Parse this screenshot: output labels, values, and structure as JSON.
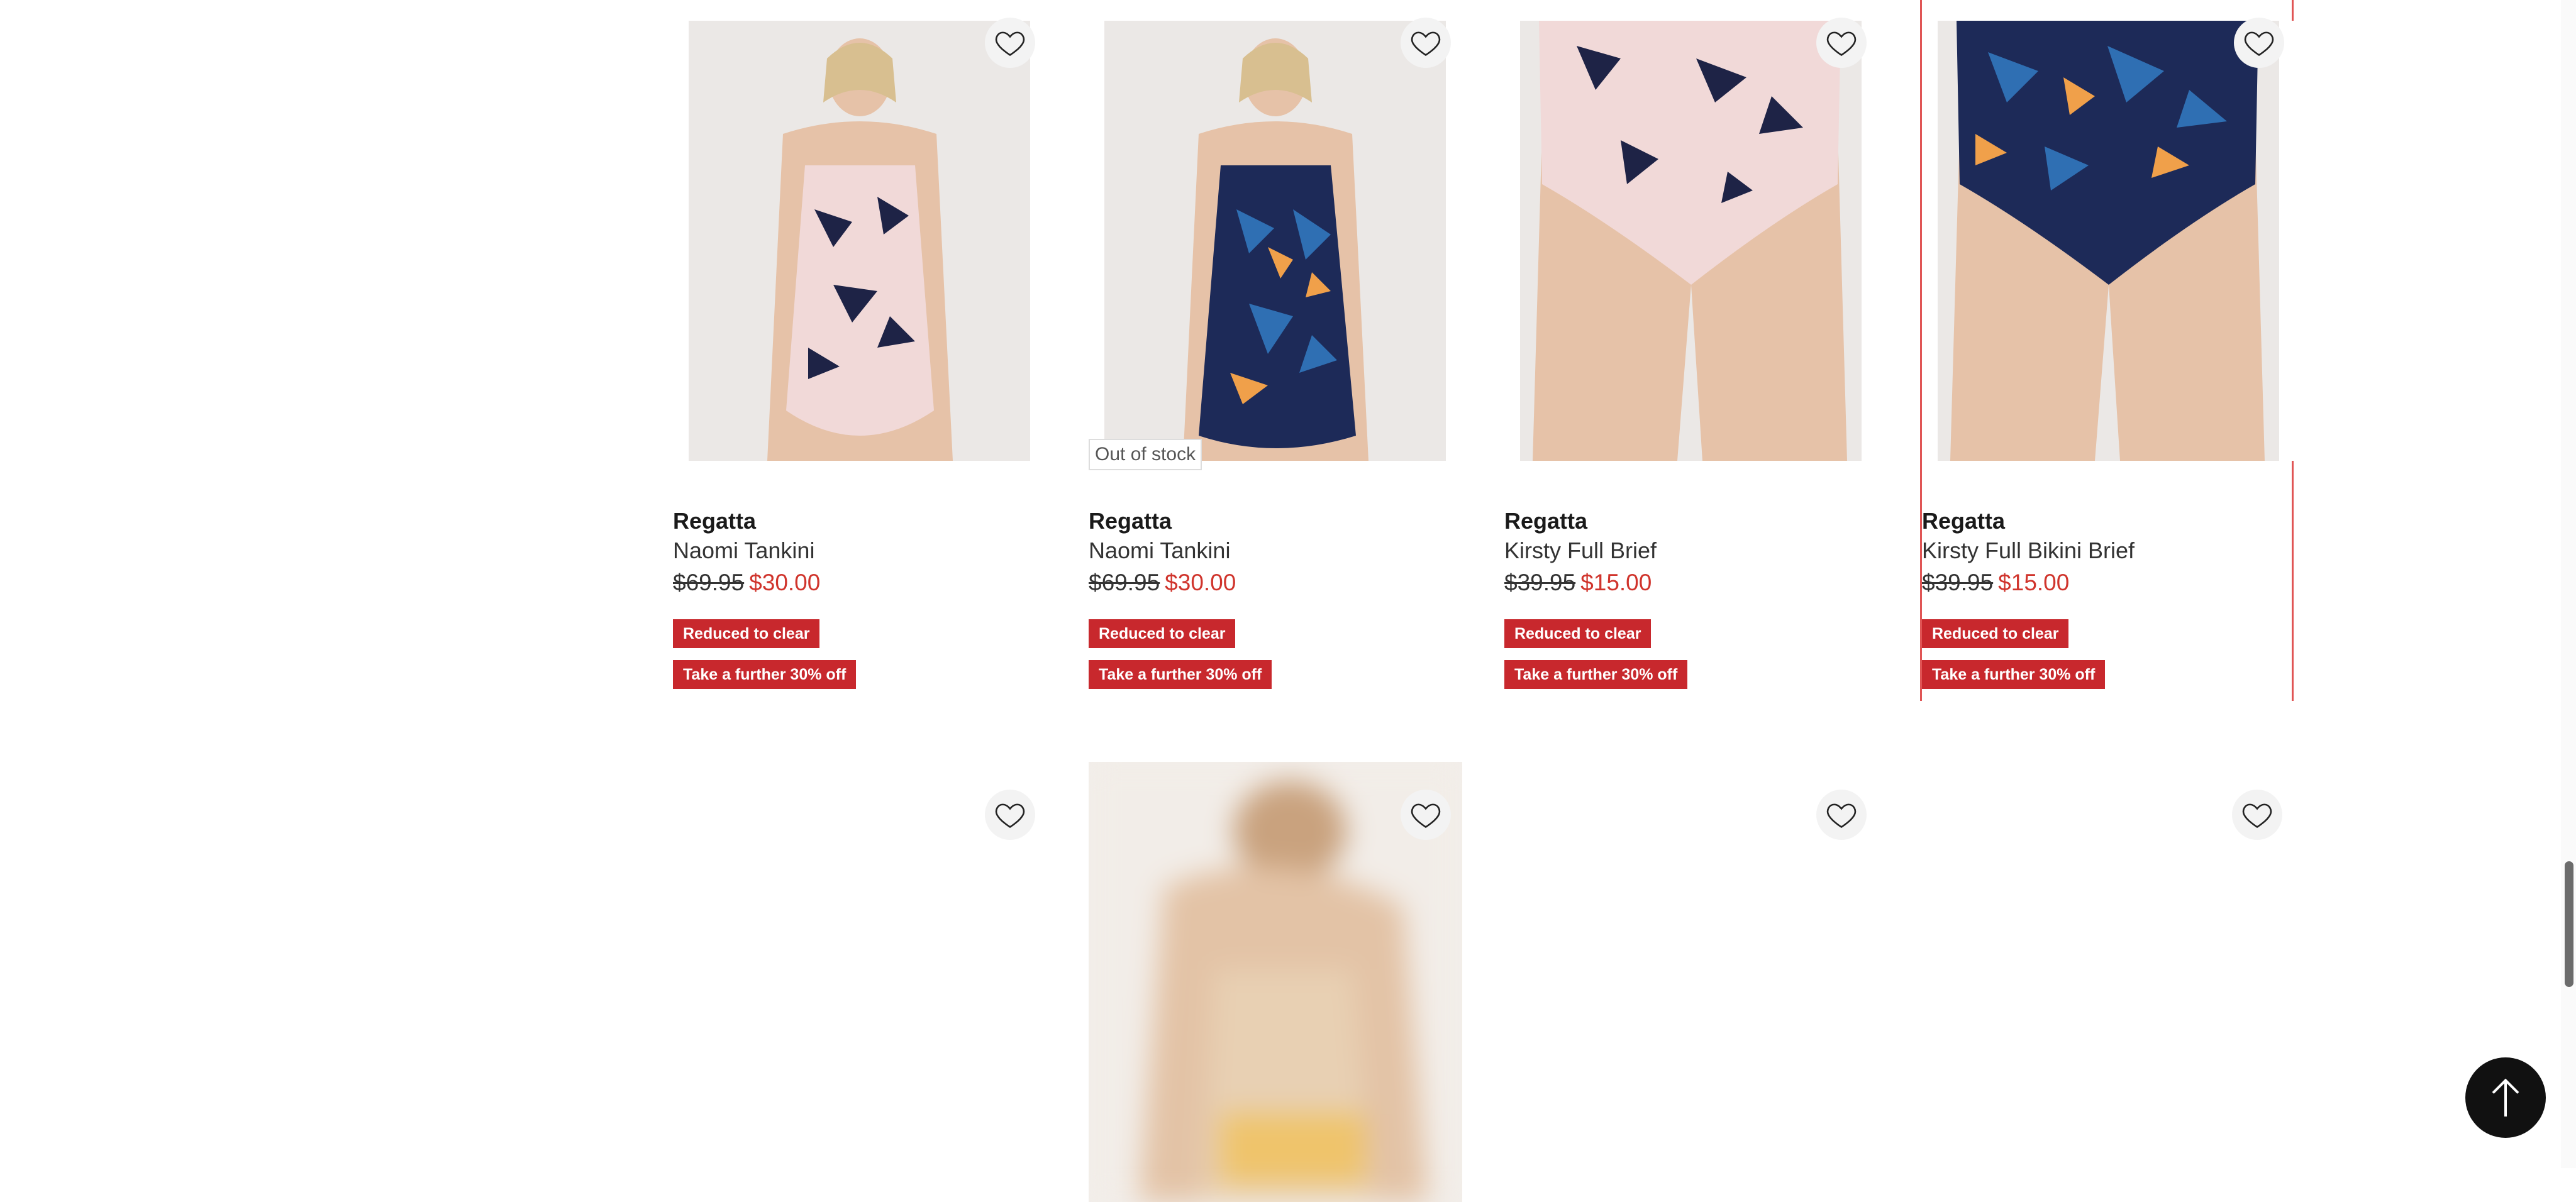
{
  "products": [
    {
      "brand": "Regatta",
      "name": "Naomi Tankini",
      "was_price": "$69.95",
      "now_price": "$30.00",
      "badge1": "Reduced to clear",
      "badge2": "Take a further 30% off",
      "out_of_stock": ""
    },
    {
      "brand": "Regatta",
      "name": "Naomi Tankini",
      "was_price": "$69.95",
      "now_price": "$30.00",
      "badge1": "Reduced to clear",
      "badge2": "Take a further 30% off",
      "out_of_stock": "Out of stock"
    },
    {
      "brand": "Regatta",
      "name": "Kirsty Full Brief",
      "was_price": "$39.95",
      "now_price": "$15.00",
      "badge1": "Reduced to clear",
      "badge2": "Take a further 30% off",
      "out_of_stock": ""
    },
    {
      "brand": "Regatta",
      "name": "Kirsty Full Bikini Brief",
      "was_price": "$39.95",
      "now_price": "$15.00",
      "badge1": "Reduced to clear",
      "badge2": "Take a further 30% off",
      "out_of_stock": ""
    }
  ],
  "icons": {
    "wishlist": "heart-outline-icon",
    "back_to_top": "arrow-up-icon"
  },
  "colors": {
    "sale_price": "#d0342c",
    "badge_bg": "#c8282d",
    "selection_border": "#e05555",
    "back_to_top_bg": "#111111"
  }
}
